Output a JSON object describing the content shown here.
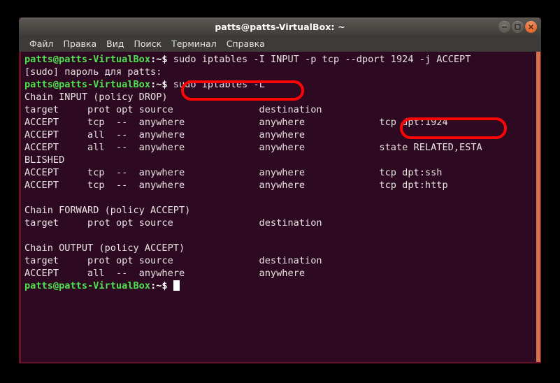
{
  "window": {
    "title": "patts@patts-VirtualBox: ~",
    "controls": [
      {
        "name": "minimize",
        "label": "–"
      },
      {
        "name": "maximize",
        "label": "□"
      },
      {
        "name": "close",
        "label": "✕"
      }
    ]
  },
  "menubar": {
    "items": [
      {
        "label": "Файл"
      },
      {
        "label": "Правка"
      },
      {
        "label": "Вид"
      },
      {
        "label": "Поиск"
      },
      {
        "label": "Терминал"
      },
      {
        "label": "Справка"
      }
    ]
  },
  "terminal": {
    "prompt_user_host": "patts@patts-VirtualBox",
    "prompt_path": ":~$",
    "lines": [
      {
        "type": "prompt",
        "command": " sudo iptables -I INPUT -p tcp --dport 1924 -j ACCEPT"
      },
      {
        "type": "plain",
        "text": "[sudo] пароль для patts:"
      },
      {
        "type": "prompt",
        "command": " sudo iptables -L"
      },
      {
        "type": "plain",
        "text": "Chain INPUT (policy DROP)"
      },
      {
        "type": "plain",
        "text": "target     prot opt source               destination"
      },
      {
        "type": "plain",
        "text": "ACCEPT     tcp  --  anywhere             anywhere             tcp dpt:1924"
      },
      {
        "type": "plain",
        "text": "ACCEPT     all  --  anywhere             anywhere"
      },
      {
        "type": "plain",
        "text": "ACCEPT     all  --  anywhere             anywhere             state RELATED,ESTA"
      },
      {
        "type": "plain",
        "text": "BLISHED"
      },
      {
        "type": "plain",
        "text": "ACCEPT     tcp  --  anywhere             anywhere             tcp dpt:ssh"
      },
      {
        "type": "plain",
        "text": "ACCEPT     tcp  --  anywhere             anywhere             tcp dpt:http"
      },
      {
        "type": "plain",
        "text": ""
      },
      {
        "type": "plain",
        "text": "Chain FORWARD (policy ACCEPT)"
      },
      {
        "type": "plain",
        "text": "target     prot opt source               destination"
      },
      {
        "type": "plain",
        "text": ""
      },
      {
        "type": "plain",
        "text": "Chain OUTPUT (policy ACCEPT)"
      },
      {
        "type": "plain",
        "text": "target     prot opt source               destination"
      },
      {
        "type": "plain",
        "text": "ACCEPT     all  --  anywhere             anywhere"
      },
      {
        "type": "prompt_cursor",
        "command": " "
      }
    ]
  },
  "annotations": [
    {
      "name": "highlight-command",
      "target_text": "sudo iptables -L",
      "color": "#fb0505"
    },
    {
      "name": "highlight-rule-port",
      "target_text": "tcp dpt:1924",
      "color": "#fb0505"
    }
  ],
  "colors": {
    "terminal_background": "#2d0922",
    "terminal_foreground": "#e8e3e0",
    "prompt_green": "#4de24d",
    "scrollbar": "#d2714a",
    "window_border": "#6b1129",
    "annotation_red": "#fb0505",
    "titlebar_top": "#5d5955",
    "titlebar_bottom": "#403d3a",
    "menubar": "#3c3b37",
    "close_button": "#e8703a"
  }
}
